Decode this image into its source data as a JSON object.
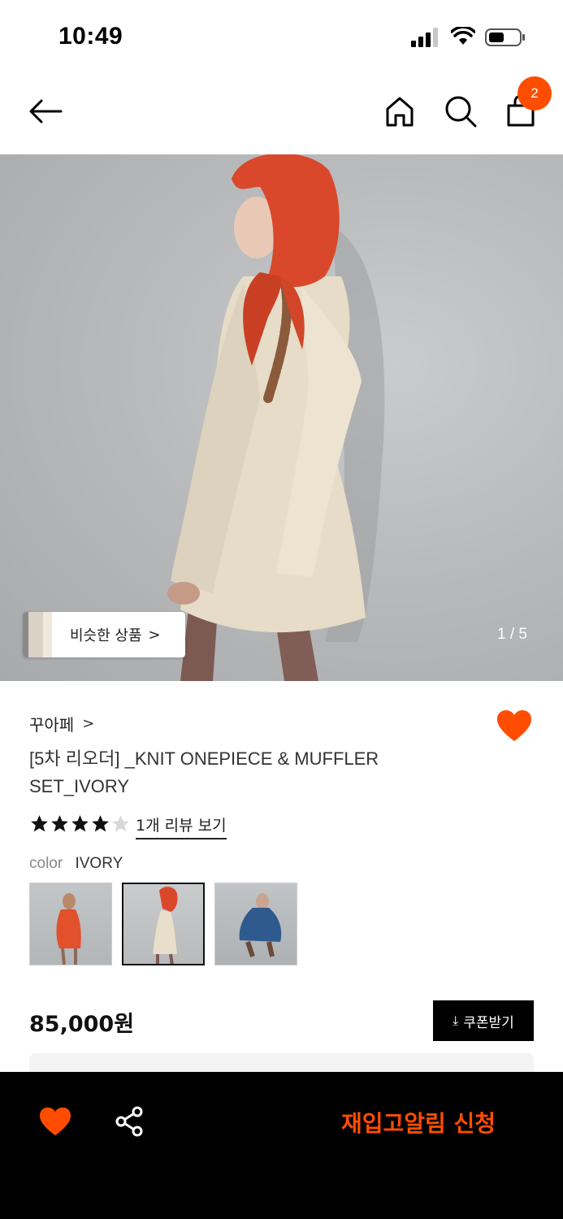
{
  "status_bar": {
    "time": "10:49"
  },
  "header": {
    "cart_count": "2"
  },
  "hero": {
    "similar_label": "비슷한 상품",
    "chevron": ">",
    "counter": "1 / 5"
  },
  "product": {
    "brand": "꾸아페",
    "brand_chevron": ">",
    "title": "[5차 리오더] _KNIT ONEPIECE & MUFFLER SET_IVORY",
    "rating": 4,
    "rating_max": 5,
    "review_link": "1개 리뷰 보기",
    "color_key": "color",
    "color_value": "IVORY",
    "swatches": [
      "orange",
      "ivory",
      "blue"
    ],
    "price": "85,000원",
    "coupon_label": "쿠폰받기",
    "coupon_icon": "download-icon"
  },
  "bottom_bar": {
    "restock_label": "재입고알림 신청"
  },
  "colors": {
    "accent": "#ff4d00",
    "black": "#000000",
    "heart": "#ff4d00"
  }
}
